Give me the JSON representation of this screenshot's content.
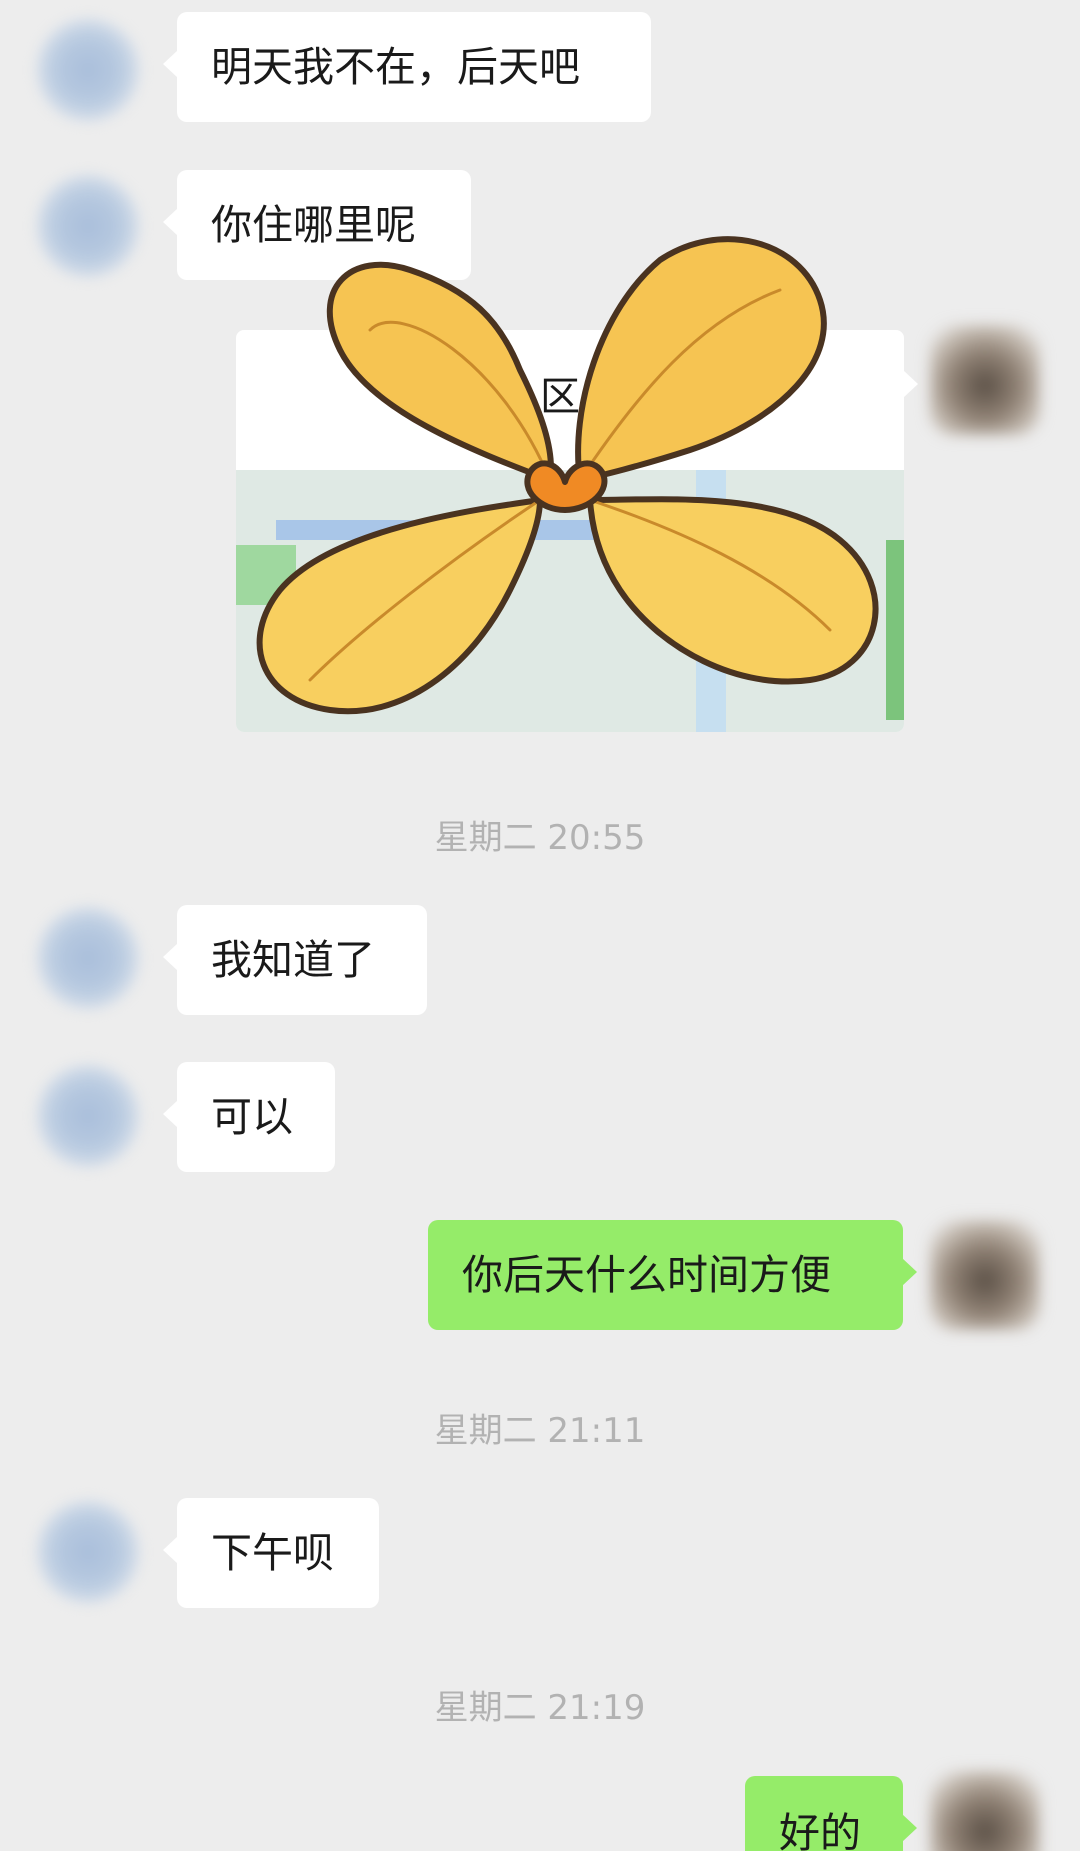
{
  "messages": {
    "m1": "明天我不在，后天吧",
    "m2": "你住哪里呢",
    "m3": "我知道了",
    "m4": "可以",
    "m5": "你后天什么时间方便",
    "m6": "下午呗",
    "m7": "好的"
  },
  "location_card": {
    "title_fragment": "区"
  },
  "timestamps": {
    "t1": "星期二 20:55",
    "t2": "星期二 21:11",
    "t3": "星期二 21:19"
  },
  "colors": {
    "background": "#ededed",
    "incoming_bubble": "#ffffff",
    "outgoing_bubble": "#95ec69",
    "timestamp_text": "#b2b2b2",
    "sticker_petal": "#f6c452",
    "sticker_center": "#f08a24"
  },
  "icons": {
    "sticker": "flower-sticker-icon"
  }
}
